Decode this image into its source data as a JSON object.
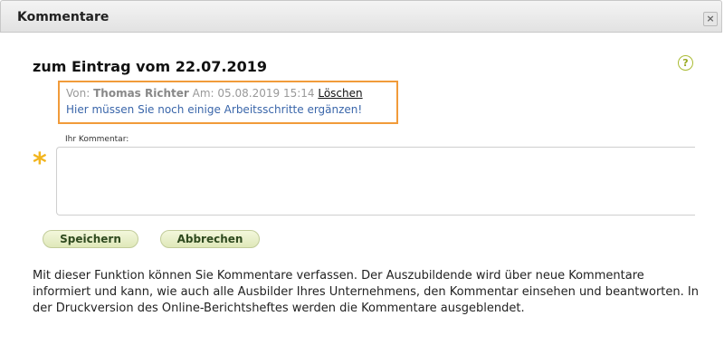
{
  "dialog": {
    "title": "Kommentare",
    "close_symbol": "×"
  },
  "main": {
    "heading": "zum Eintrag vom 22.07.2019",
    "help_symbol": "?"
  },
  "comment": {
    "from_label": "Von:",
    "author": "Thomas Richter",
    "date_label": "Am:",
    "datetime": "05.08.2019 15:14",
    "delete_label": "Löschen",
    "text": "Hier müssen Sie noch einige Arbeitsschritte ergänzen!"
  },
  "form": {
    "field_label": "Ihr Kommentar:",
    "required_marker": "*",
    "value": "",
    "save_label": "Speichern",
    "cancel_label": "Abbrechen"
  },
  "info_text": "Mit dieser Funktion können Sie Kommentare verfassen. Der Auszubildende wird über neue Kommentare informiert und kann, wie auch alle Ausbilder Ihres Unternehmens, den Kommentar einsehen und beantworten. In der Druckversion des Online-Berichtsheftes werden die Kommentare ausgeblendet.",
  "colors": {
    "highlight_border": "#f19b3a",
    "required_star": "#f2b51f",
    "comment_text": "#3a66aa",
    "button_bg": "#dfe8b9"
  },
  "icons": {
    "close": "close-icon",
    "help": "help-icon"
  }
}
